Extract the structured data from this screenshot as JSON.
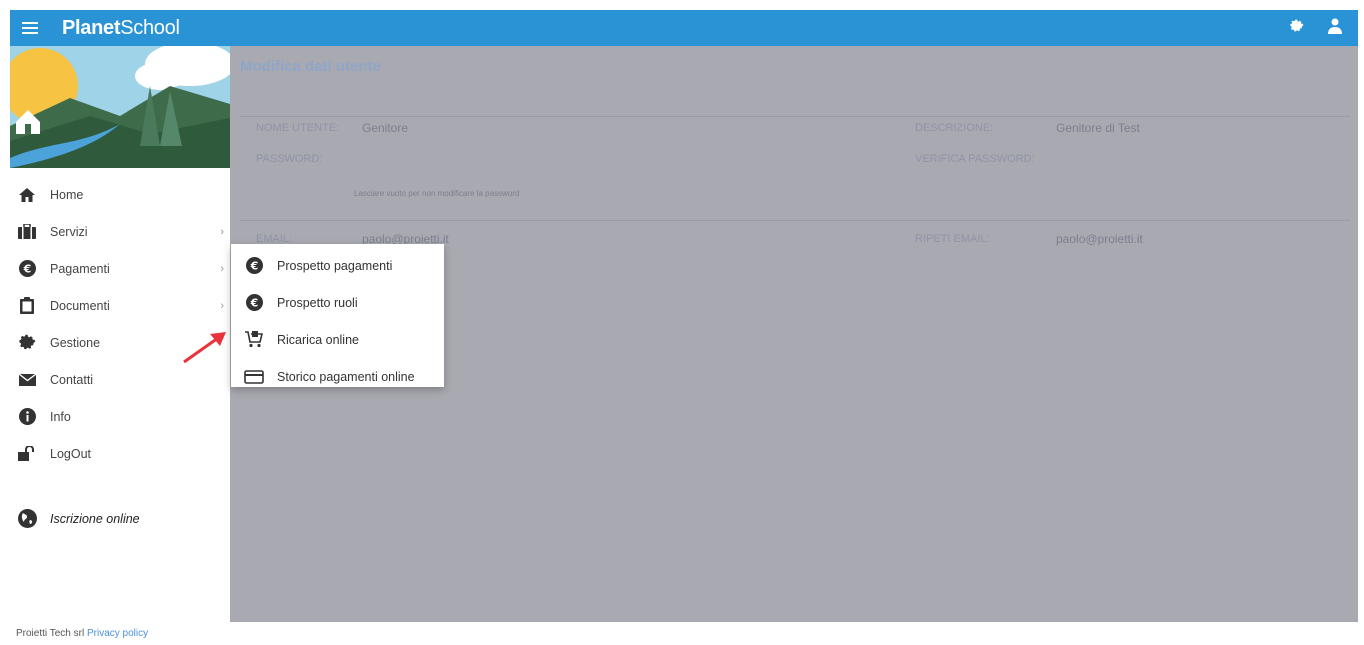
{
  "app": {
    "brand_bold": "Planet",
    "brand_light": "School",
    "accent_color": "#2a93d5"
  },
  "topbar": {
    "menu_icon": "hamburger-icon",
    "settings_icon": "gear-icon",
    "user_icon": "user-icon"
  },
  "sidebar": {
    "items": [
      {
        "label": "Home",
        "icon": "home-icon"
      },
      {
        "label": "Servizi",
        "icon": "briefcase-icon"
      },
      {
        "label": "Pagamenti",
        "icon": "euro-icon"
      },
      {
        "label": "Documenti",
        "icon": "clipboard-icon"
      },
      {
        "label": "Gestione",
        "icon": "gear-icon"
      },
      {
        "label": "Contatti",
        "icon": "envelope-icon"
      },
      {
        "label": "Info",
        "icon": "info-icon"
      },
      {
        "label": "LogOut",
        "icon": "unlock-icon"
      }
    ],
    "iscrizione": {
      "label": "Iscrizione online",
      "icon": "globe-icon"
    }
  },
  "submenu": {
    "items": [
      {
        "label": "Prospetto pagamenti",
        "icon": "euro-icon"
      },
      {
        "label": "Prospetto ruoli",
        "icon": "euro-icon"
      },
      {
        "label": "Ricarica online",
        "icon": "cart-icon"
      },
      {
        "label": "Storico pagamenti online",
        "icon": "credit-card-icon"
      }
    ]
  },
  "main": {
    "title": "Modifica dati utente",
    "form": {
      "nome_utente_label": "NOME UTENTE:",
      "nome_utente_value": "Genitore",
      "password_label": "PASSWORD:",
      "password_hint": "Lasciare vuoto per non modificare la password",
      "email_label": "EMAIL:",
      "email_value": "paolo@proietti.it",
      "descrizione_label": "DESCRIZIONE:",
      "descrizione_value": "Genitore di Test",
      "verifica_password_label": "VERIFICA PASSWORD:",
      "ripeti_email_label": "RIPETI EMAIL:",
      "ripeti_email_value": "paolo@proietti.it"
    }
  },
  "footer": {
    "company": "Proietti Tech srl",
    "privacy": "Privacy policy"
  }
}
